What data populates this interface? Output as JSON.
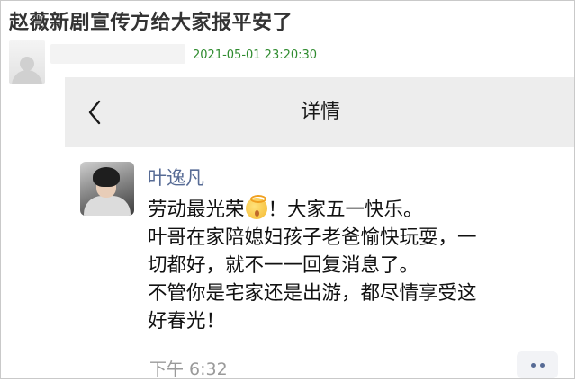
{
  "post": {
    "title": "赵薇新剧宣传方给大家报平安了",
    "time": "2021-05-01 23:20:30"
  },
  "nav": {
    "title": "详情",
    "back_icon": "chevron-left-icon"
  },
  "moment": {
    "name": "叶逸凡",
    "lines": [
      "劳动最光荣",
      "！大家五一快乐。",
      "叶哥在家陪媳妇孩子老爸愉快玩耍，一",
      "切都好，就不一一回复消息了。",
      "不管你是宅家还是出游，都尽情享受这",
      "好春光！"
    ],
    "emoji": "shushing-face-with-halo-emoji",
    "time": "下午 6:32",
    "more_icon": "more-dots-icon"
  },
  "colors": {
    "name_blue": "#576b95",
    "time_green": "#2e8b2e",
    "navbar_bg": "#ededed"
  }
}
